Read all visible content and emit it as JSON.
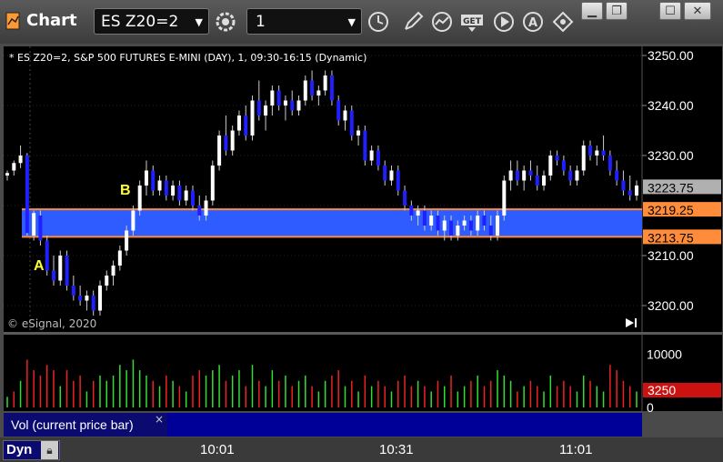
{
  "window": {
    "title": "Chart",
    "minimize_icon": "minimize-icon",
    "restore_icon": "restore-icon",
    "maximize_icon": "maximize-icon",
    "close_icon": "close-icon"
  },
  "toolbar": {
    "symbol_value": "ES Z20=2",
    "interval_value": "1",
    "icons": [
      "symbol-settings-icon",
      "clock-icon",
      "draw-pencil-icon",
      "studies-icon",
      "get-data-icon",
      "play-icon",
      "alert-icon",
      "diamond-tool-icon"
    ]
  },
  "chart": {
    "header": "* ES Z20=2, S&P 500 FUTURES E-MINI (DAY), 1, 09:30-16:15 (Dynamic)",
    "copyright": "© eSignal, 2020",
    "label_a": "A",
    "label_b": "B",
    "price_ticks": [
      "3250.00",
      "3240.00",
      "3230.00",
      "3210.00",
      "3200.00"
    ],
    "last_price": "3223.75",
    "zone_high": "3219.25",
    "zone_low": "3213.75",
    "colors": {
      "zone": "#2f5cff",
      "zone_line": "#ff8c3a",
      "up": "#ffffff",
      "down": "#2020ff",
      "label": "#ffff33"
    }
  },
  "volume": {
    "title": "Vol (current price bar)",
    "ticks": [
      "10000",
      "0"
    ],
    "current": "3250",
    "close_icon": "close-icon",
    "colors": {
      "up": "#33dd33",
      "down": "#ee2222",
      "badge": "#cc1111"
    }
  },
  "time_axis": [
    "10:01",
    "10:31",
    "11:01"
  ],
  "footer": {
    "mode": "Dyn",
    "lock_icon": "lock-icon"
  },
  "chart_data": {
    "type": "candlestick",
    "title": "* ES Z20=2, S&P 500 FUTURES E-MINI (DAY), 1, 09:30-16:15 (Dynamic)",
    "ylim": [
      3197,
      3253
    ],
    "x_ticks": [
      "10:01",
      "10:31",
      "11:01"
    ],
    "zone": [
      3213.75,
      3219.25
    ],
    "bars": [
      [
        3226,
        3227,
        3225,
        3226.5
      ],
      [
        3227,
        3229,
        3226,
        3228.5
      ],
      [
        3228.5,
        3232,
        3227.5,
        3230
      ],
      [
        3230,
        3230.5,
        3214,
        3214.5
      ],
      [
        3214,
        3219,
        3213,
        3218.5
      ],
      [
        3218,
        3219,
        3212,
        3213
      ],
      [
        3213,
        3214,
        3206,
        3207
      ],
      [
        3207,
        3210,
        3204,
        3205
      ],
      [
        3205,
        3211,
        3204,
        3210
      ],
      [
        3210,
        3211,
        3203,
        3204
      ],
      [
        3204,
        3206,
        3201,
        3202
      ],
      [
        3202,
        3204,
        3200,
        3201
      ],
      [
        3201,
        3203,
        3199,
        3202
      ],
      [
        3202,
        3203,
        3198,
        3199
      ],
      [
        3199,
        3205,
        3198,
        3204
      ],
      [
        3204,
        3207,
        3203,
        3206
      ],
      [
        3206,
        3209,
        3204,
        3208
      ],
      [
        3208,
        3212,
        3207,
        3211
      ],
      [
        3211,
        3216,
        3210,
        3215
      ],
      [
        3215,
        3220,
        3214,
        3219
      ],
      [
        3219,
        3225,
        3218,
        3224
      ],
      [
        3224,
        3229,
        3222,
        3227
      ],
      [
        3227,
        3228,
        3222,
        3223
      ],
      [
        3223,
        3226,
        3222,
        3225
      ],
      [
        3225,
        3226,
        3221,
        3222
      ],
      [
        3222,
        3225,
        3221,
        3224
      ],
      [
        3224,
        3225,
        3220,
        3221
      ],
      [
        3221,
        3224,
        3220,
        3223
      ],
      [
        3223,
        3224,
        3219,
        3220
      ],
      [
        3220,
        3222,
        3217,
        3218
      ],
      [
        3218,
        3222,
        3217,
        3221
      ],
      [
        3221,
        3229,
        3220,
        3228
      ],
      [
        3228,
        3235,
        3227,
        3234
      ],
      [
        3234,
        3238,
        3230,
        3231
      ],
      [
        3231,
        3236,
        3230,
        3235
      ],
      [
        3235,
        3239,
        3234,
        3238
      ],
      [
        3238,
        3240,
        3233,
        3234
      ],
      [
        3234,
        3242,
        3233,
        3241
      ],
      [
        3241,
        3245,
        3237,
        3238
      ],
      [
        3238,
        3241,
        3235,
        3240
      ],
      [
        3240,
        3244,
        3238,
        3243
      ],
      [
        3243,
        3244,
        3239,
        3240
      ],
      [
        3240,
        3242,
        3237,
        3241
      ],
      [
        3241,
        3243,
        3238,
        3239
      ],
      [
        3239,
        3242,
        3238,
        3241
      ],
      [
        3241,
        3246,
        3240,
        3245
      ],
      [
        3245,
        3247,
        3241,
        3242
      ],
      [
        3242,
        3244,
        3240,
        3243
      ],
      [
        3243,
        3247,
        3242,
        3246
      ],
      [
        3246,
        3247,
        3240,
        3241
      ],
      [
        3241,
        3242,
        3236,
        3237
      ],
      [
        3237,
        3240,
        3235,
        3239
      ],
      [
        3239,
        3240,
        3233,
        3234
      ],
      [
        3234,
        3236,
        3232,
        3235
      ],
      [
        3235,
        3236,
        3228,
        3229
      ],
      [
        3229,
        3232,
        3228,
        3231
      ],
      [
        3231,
        3232,
        3227,
        3228
      ],
      [
        3228,
        3229,
        3224,
        3225
      ],
      [
        3225,
        3228,
        3224,
        3227
      ],
      [
        3227,
        3228,
        3222,
        3223
      ],
      [
        3223,
        3224,
        3219,
        3220
      ],
      [
        3220,
        3221,
        3217,
        3218
      ],
      [
        3218,
        3220,
        3216,
        3219
      ],
      [
        3219,
        3220,
        3215,
        3216
      ],
      [
        3216,
        3219,
        3215,
        3218
      ],
      [
        3218,
        3219,
        3214,
        3215
      ],
      [
        3215,
        3218,
        3213,
        3217
      ],
      [
        3217,
        3218,
        3213,
        3214
      ],
      [
        3214,
        3217,
        3213,
        3216
      ],
      [
        3216,
        3218,
        3215,
        3217
      ],
      [
        3217,
        3218,
        3214,
        3215
      ],
      [
        3215,
        3219,
        3214,
        3218
      ],
      [
        3218,
        3219,
        3215,
        3216
      ],
      [
        3216,
        3218,
        3213,
        3214
      ],
      [
        3214,
        3219,
        3213,
        3218
      ],
      [
        3218,
        3226,
        3217,
        3225
      ],
      [
        3225,
        3229,
        3223,
        3227
      ],
      [
        3227,
        3229,
        3224,
        3225
      ],
      [
        3225,
        3228,
        3223,
        3227
      ],
      [
        3227,
        3229,
        3225,
        3226
      ],
      [
        3226,
        3228,
        3223,
        3224
      ],
      [
        3224,
        3227,
        3223,
        3226
      ],
      [
        3226,
        3231,
        3225,
        3230
      ],
      [
        3230,
        3231,
        3228,
        3229
      ],
      [
        3229,
        3230,
        3226,
        3227
      ],
      [
        3227,
        3228,
        3224,
        3225
      ],
      [
        3225,
        3228,
        3224,
        3227
      ],
      [
        3227,
        3233,
        3226,
        3232
      ],
      [
        3232,
        3233,
        3229,
        3230
      ],
      [
        3230,
        3232,
        3228,
        3231
      ],
      [
        3231,
        3234,
        3229,
        3230
      ],
      [
        3230,
        3231,
        3226,
        3227
      ],
      [
        3227,
        3229,
        3224,
        3225
      ],
      [
        3225,
        3227,
        3222,
        3223
      ],
      [
        3223,
        3226,
        3221,
        3222
      ],
      [
        3222,
        3225,
        3221,
        3224
      ]
    ],
    "volume": [
      [
        2,
        1
      ],
      [
        3,
        0
      ],
      [
        5,
        1
      ],
      [
        9,
        0
      ],
      [
        7,
        0
      ],
      [
        6,
        0
      ],
      [
        8,
        0
      ],
      [
        7,
        0
      ],
      [
        4,
        1
      ],
      [
        7,
        0
      ],
      [
        5,
        0
      ],
      [
        6,
        0
      ],
      [
        3,
        1
      ],
      [
        5,
        0
      ],
      [
        6,
        1
      ],
      [
        5,
        1
      ],
      [
        6,
        1
      ],
      [
        8,
        1
      ],
      [
        7,
        1
      ],
      [
        9,
        1
      ],
      [
        7,
        1
      ],
      [
        6,
        1
      ],
      [
        5,
        0
      ],
      [
        4,
        1
      ],
      [
        6,
        0
      ],
      [
        5,
        1
      ],
      [
        4,
        0
      ],
      [
        3,
        1
      ],
      [
        6,
        0
      ],
      [
        7,
        0
      ],
      [
        6,
        1
      ],
      [
        7,
        1
      ],
      [
        8,
        1
      ],
      [
        5,
        0
      ],
      [
        6,
        1
      ],
      [
        7,
        1
      ],
      [
        4,
        0
      ],
      [
        8,
        1
      ],
      [
        5,
        0
      ],
      [
        4,
        1
      ],
      [
        7,
        1
      ],
      [
        5,
        0
      ],
      [
        6,
        1
      ],
      [
        4,
        0
      ],
      [
        5,
        1
      ],
      [
        6,
        1
      ],
      [
        4,
        0
      ],
      [
        3,
        1
      ],
      [
        5,
        1
      ],
      [
        6,
        0
      ],
      [
        7,
        0
      ],
      [
        4,
        1
      ],
      [
        5,
        0
      ],
      [
        3,
        1
      ],
      [
        6,
        0
      ],
      [
        4,
        1
      ],
      [
        5,
        0
      ],
      [
        4,
        0
      ],
      [
        3,
        1
      ],
      [
        5,
        0
      ],
      [
        6,
        0
      ],
      [
        4,
        0
      ],
      [
        5,
        1
      ],
      [
        4,
        0
      ],
      [
        3,
        1
      ],
      [
        5,
        0
      ],
      [
        4,
        1
      ],
      [
        6,
        0
      ],
      [
        3,
        1
      ],
      [
        4,
        1
      ],
      [
        5,
        0
      ],
      [
        6,
        1
      ],
      [
        4,
        0
      ],
      [
        5,
        0
      ],
      [
        7,
        1
      ],
      [
        6,
        1
      ],
      [
        5,
        1
      ],
      [
        3,
        0
      ],
      [
        4,
        1
      ],
      [
        5,
        0
      ],
      [
        4,
        0
      ],
      [
        3,
        1
      ],
      [
        6,
        1
      ],
      [
        4,
        0
      ],
      [
        5,
        0
      ],
      [
        4,
        0
      ],
      [
        3,
        1
      ],
      [
        6,
        1
      ],
      [
        5,
        0
      ],
      [
        4,
        1
      ],
      [
        3,
        1
      ],
      [
        8,
        0
      ],
      [
        7,
        0
      ],
      [
        5,
        0
      ],
      [
        4,
        0
      ],
      [
        3,
        1
      ]
    ],
    "volume_ylim": [
      0,
      13000
    ]
  }
}
